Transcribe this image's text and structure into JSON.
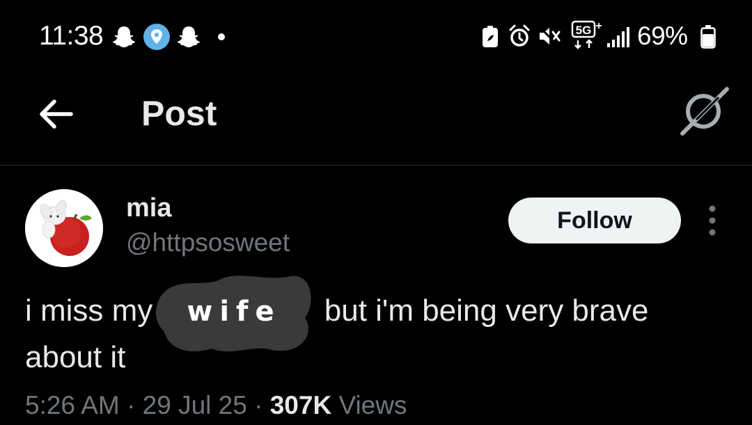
{
  "status_bar": {
    "time": "11:38",
    "battery_percent": "69%",
    "network": "5G",
    "icons": [
      "snapchat-icon",
      "location-icon",
      "snapchat-icon",
      "notification-dot-icon",
      "battery-saver-icon",
      "alarm-icon",
      "mute-icon",
      "5g-icon",
      "signal-icon",
      "battery-icon"
    ]
  },
  "header": {
    "title": "Post",
    "back_icon": "arrow-left-icon",
    "grok_icon": "grok-icon"
  },
  "post": {
    "author": {
      "name": "mia",
      "handle": "@httpsosweet"
    },
    "follow_label": "Follow",
    "more_icon": "more-vertical-icon",
    "text": {
      "before": "i miss my ",
      "scribble": "wife",
      "after": " but i'm being very brave about it"
    },
    "meta": {
      "time": "5:26 AM",
      "date": "29 Jul 25",
      "views_count": "307K",
      "views_label": "Views",
      "separator": "·"
    }
  },
  "colors": {
    "background": "#000000",
    "text_primary": "#e7e9ea",
    "text_secondary": "#71767b",
    "follow_bg": "#eff3f4",
    "divider": "#2f3336",
    "scribble": "#3a3a3a"
  }
}
